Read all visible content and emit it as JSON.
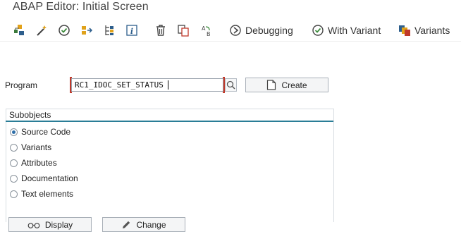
{
  "window": {
    "title": "ABAP Editor: Initial Screen"
  },
  "toolbar": {
    "icons": [
      "object-list-icon",
      "magic-wand-icon",
      "check-icon",
      "activate-icon",
      "where-used-icon",
      "info-icon",
      "delete-icon",
      "copy-icon",
      "rename-icon"
    ],
    "debugging_label": "Debugging",
    "with_variant_label": "With Variant",
    "variants_label": "Variants"
  },
  "program": {
    "label": "Program",
    "value": "RC1_IDOC_SET_STATUS",
    "create_label": "Create"
  },
  "subobjects": {
    "title": "Subobjects",
    "options": [
      {
        "label": "Source Code",
        "checked": true
      },
      {
        "label": "Variants",
        "checked": false
      },
      {
        "label": "Attributes",
        "checked": false
      },
      {
        "label": "Documentation",
        "checked": false
      },
      {
        "label": "Text elements",
        "checked": false
      }
    ]
  },
  "actions": {
    "display_label": "Display",
    "change_label": "Change"
  },
  "colors": {
    "accent": "#2a7d97",
    "required": "#c0392b"
  }
}
